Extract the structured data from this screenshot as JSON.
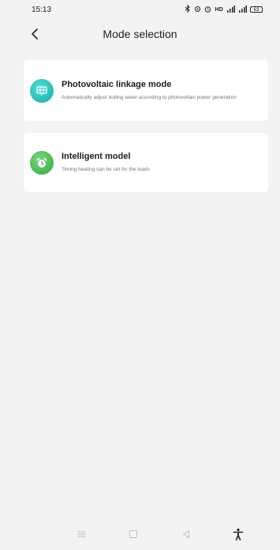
{
  "status_bar": {
    "time": "15:13",
    "indicators": "✱ ⚙ ◷ HD",
    "signal_1": "ᵃᵢˡ",
    "signal_2": "ᵃᵢˡ",
    "battery": "63"
  },
  "header": {
    "title": "Mode selection",
    "back_icon": "chevron-left-icon"
  },
  "modes": [
    {
      "title": "Photovoltaic linkage mode",
      "description": "Automatically adjust boiling water according to photovoltaic power generation",
      "icon": "solar-panel-icon",
      "icon_color": "#2ec3bf"
    },
    {
      "title": "Intelligent model",
      "description": "Timing heating can be set for the loads",
      "icon": "alarm-clock-icon",
      "icon_color": "#55bb5c"
    }
  ],
  "bottom_nav": {
    "menu_icon": "menu-icon",
    "home_icon": "home-square-icon",
    "back_icon": "back-triangle-icon",
    "accessibility_icon": "accessibility-icon"
  }
}
